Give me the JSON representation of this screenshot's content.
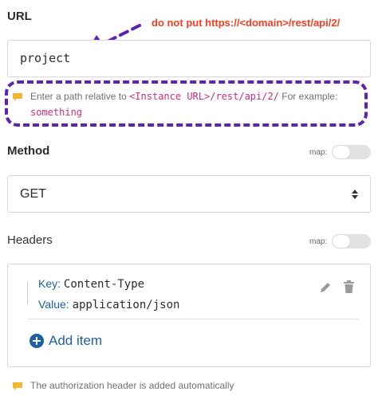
{
  "url_section": {
    "label": "URL",
    "value": "project",
    "hint_prefix": "Enter a path relative to ",
    "hint_code": "<Instance URL>/rest/api/2/",
    "hint_suffix": " For example:",
    "hint_example": "something"
  },
  "annotation": {
    "text": "do not put https://<domain>/rest/api/2/",
    "color": "#ff3b1f",
    "arrow_color": "#5c23b5"
  },
  "method_section": {
    "label": "Method",
    "map_label": "map:",
    "selected": "GET"
  },
  "headers_section": {
    "label": "Headers",
    "map_label": "map:",
    "items": [
      {
        "key_label": "Key:",
        "key": "Content-Type",
        "value_label": "Value:",
        "value": "application/json"
      }
    ],
    "add_item_label": "Add item",
    "footer_hint": "The authorization header is added automatically"
  },
  "colors": {
    "accent_blue": "#1f5fa8",
    "code_pink": "#d02b7a",
    "hint_icon_yellow": "#f2b632"
  },
  "icons": [
    "comment-hint-icon",
    "chevron-up-down-icon",
    "pencil-icon",
    "trash-icon",
    "plus-circle-icon",
    "arrow-annotation-icon"
  ]
}
